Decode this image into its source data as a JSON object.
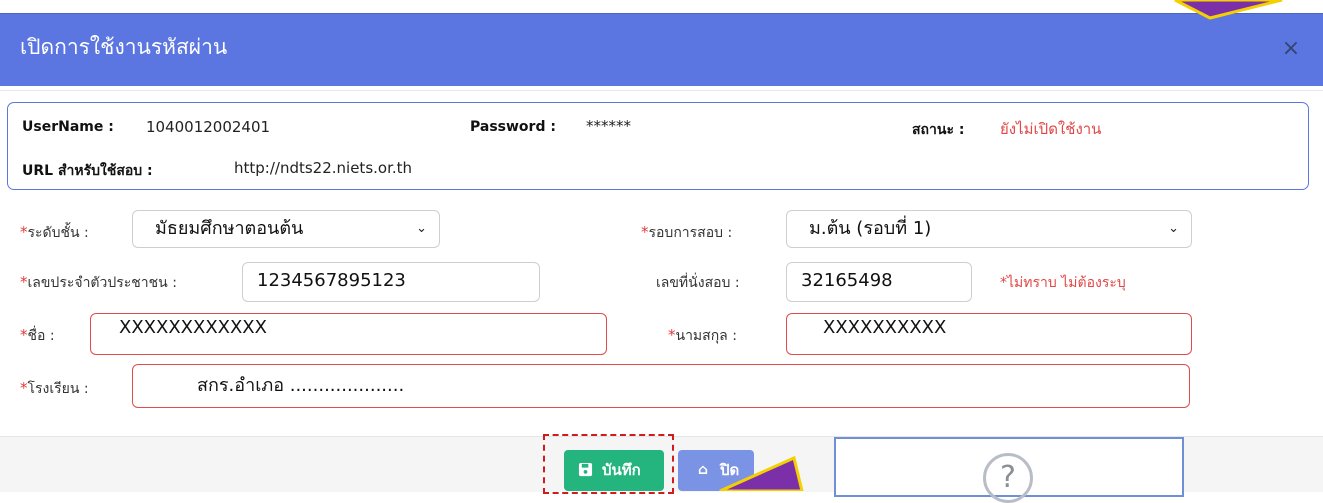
{
  "dialog": {
    "title": "เปิดการใช้งานรหัสผ่าน",
    "close_icon": "×"
  },
  "info": {
    "username_label": "UserName :",
    "username_value": "1040012002401",
    "password_label": "Password :",
    "password_value": "******",
    "status_label": "สถานะ :",
    "status_value": "ยังไม่เปิดใช้งาน",
    "url_label": "URL สำหรับใช้สอบ :",
    "url_value": "http://ndts22.niets.or.th"
  },
  "form": {
    "required_mark": "*",
    "level_label": "ระดับชั้น :",
    "level_value": "มัธยมศึกษาตอนต้น",
    "round_label": "รอบการสอบ :",
    "round_value": "ม.ต้น (รอบที่ 1)",
    "citizen_label": "เลขประจำตัวประชาชน :",
    "citizen_value": "1234567895123",
    "seat_label": "เลขที่นั่งสอบ :",
    "seat_value": "32165498",
    "seat_hint": "*ไม่ทราบ ไม่ต้องระบุ",
    "firstname_label": "ชื่อ :",
    "firstname_value": "XXXXXXXXXXXX",
    "lastname_label": "นามสกุล :",
    "lastname_value": "XXXXXXXXXX",
    "school_label": "โรงเรียน :",
    "school_value": "สกร.อำเภอ ...................."
  },
  "buttons": {
    "save_label": "บันทึก",
    "close_label": "ปิด"
  },
  "help": {
    "symbol": "?"
  },
  "colors": {
    "header": "#5b76e0",
    "save": "#24b47e",
    "error": "#e24545",
    "annotation_arrow": "#7b2fa8"
  }
}
